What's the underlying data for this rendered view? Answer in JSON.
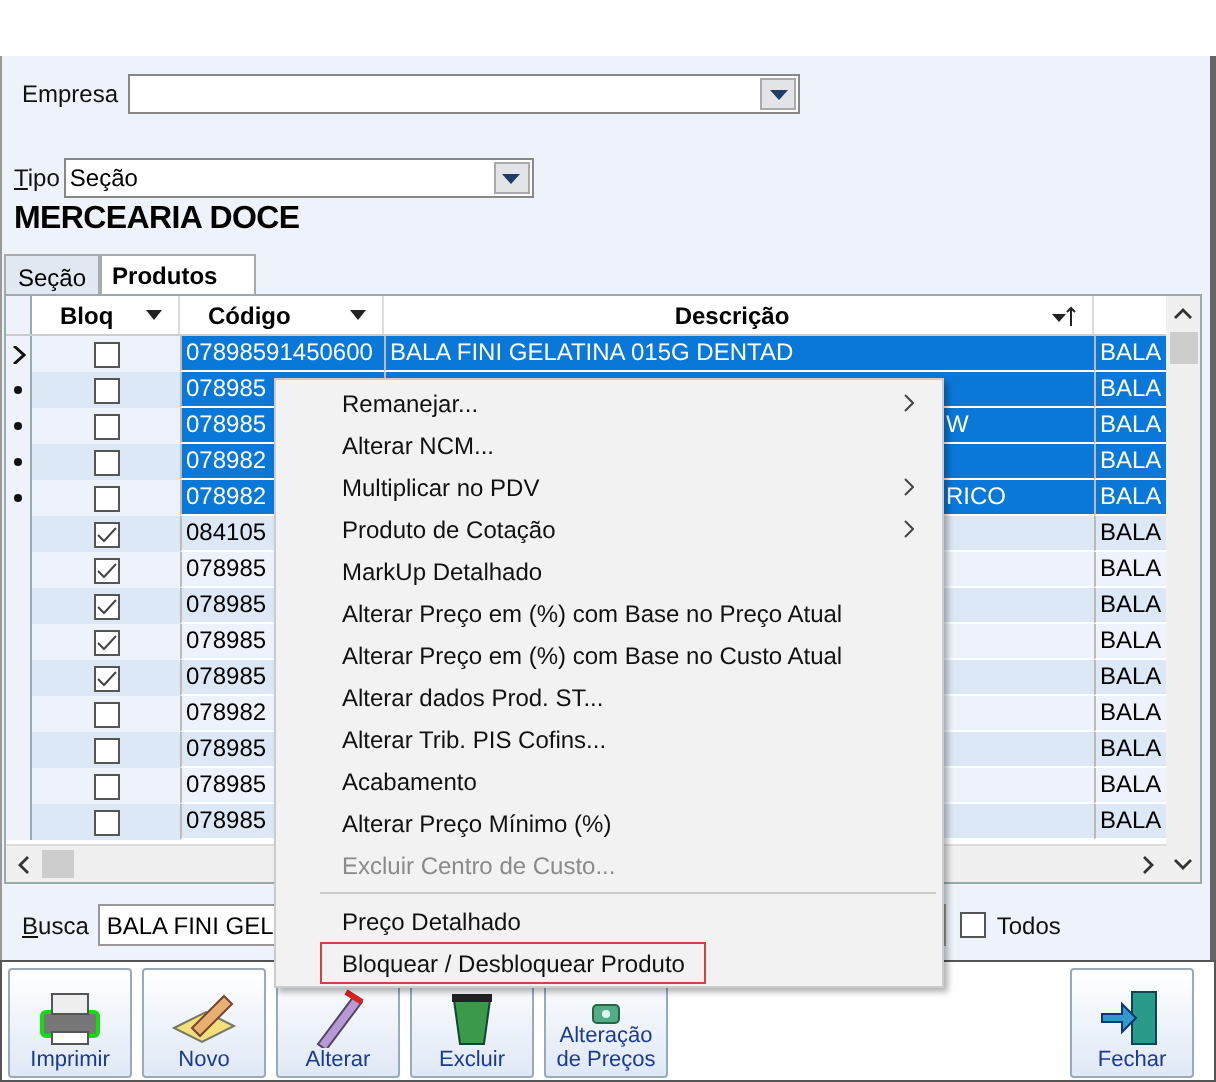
{
  "empresa": {
    "label": "Empresa"
  },
  "tipo": {
    "label": "Tipo",
    "value": "Seção"
  },
  "section_title": "MERCEARIA DOCE",
  "tabs": [
    {
      "label": "Seção",
      "selected": false
    },
    {
      "label": "Produtos",
      "selected": true
    }
  ],
  "table": {
    "columns": [
      "Bloq",
      "Código",
      "Descrição"
    ],
    "rows": [
      {
        "current": true,
        "selected": true,
        "checked": false,
        "code": "07898591450600",
        "description": "BALA FINI GELATINA 015G DENTAD",
        "column_4": "BALA"
      },
      {
        "current": false,
        "selected": true,
        "checked": false,
        "code": "078985",
        "description": "",
        "column_4": "BALA"
      },
      {
        "current": false,
        "selected": true,
        "checked": false,
        "code": "078985",
        "description": "W",
        "column_4": "BALA"
      },
      {
        "current": false,
        "selected": true,
        "checked": false,
        "code": "078982",
        "description": "",
        "column_4": "BALA"
      },
      {
        "current": false,
        "selected": true,
        "checked": false,
        "code": "078982",
        "description": "RICO",
        "column_4": "BALA"
      },
      {
        "current": false,
        "selected": false,
        "checked": true,
        "code": "084105",
        "description": "",
        "column_4": "BALA"
      },
      {
        "current": false,
        "selected": false,
        "checked": true,
        "code": "078985",
        "description": "",
        "column_4": "BALA"
      },
      {
        "current": false,
        "selected": false,
        "checked": true,
        "code": "078985",
        "description": "",
        "column_4": "BALA"
      },
      {
        "current": false,
        "selected": false,
        "checked": true,
        "code": "078985",
        "description": "",
        "column_4": "BALA"
      },
      {
        "current": false,
        "selected": false,
        "checked": true,
        "code": "078985",
        "description": "",
        "column_4": "BALA"
      },
      {
        "current": false,
        "selected": false,
        "checked": false,
        "code": "078982",
        "description": "",
        "column_4": "BALA"
      },
      {
        "current": false,
        "selected": false,
        "checked": false,
        "code": "078985",
        "description": "",
        "column_4": "BALA"
      },
      {
        "current": false,
        "selected": false,
        "checked": false,
        "code": "078985",
        "description": "",
        "column_4": "BALA"
      },
      {
        "current": false,
        "selected": false,
        "checked": false,
        "code": "078985",
        "description": "",
        "column_4": "BALA"
      }
    ]
  },
  "busca": {
    "label": "Busca",
    "value": "BALA FINI GEL"
  },
  "todos": {
    "label": "Todos",
    "checked": false
  },
  "toolbar": [
    {
      "kind": "print",
      "label": "Imprimir"
    },
    {
      "kind": "new",
      "label": "Novo"
    },
    {
      "kind": "edit",
      "label": "Alterar"
    },
    {
      "kind": "delete",
      "label": "Excluir"
    },
    {
      "kind": "prices",
      "label": "Alteração de Preços"
    },
    {
      "kind": "close",
      "label": "Fechar"
    }
  ],
  "context_menu": [
    {
      "kind": "item",
      "label": "Remanejar...",
      "submenu": true,
      "disabled": false,
      "selected": false
    },
    {
      "kind": "item",
      "label": "Alterar NCM...",
      "submenu": false,
      "disabled": false,
      "selected": false
    },
    {
      "kind": "item",
      "label": "Multiplicar no PDV",
      "submenu": true,
      "disabled": false,
      "selected": false
    },
    {
      "kind": "item",
      "label": "Produto de Cotação",
      "submenu": true,
      "disabled": false,
      "selected": false
    },
    {
      "kind": "item",
      "label": "MarkUp Detalhado",
      "submenu": false,
      "disabled": false,
      "selected": false
    },
    {
      "kind": "item",
      "label": "Alterar Preço em (%) com Base no Preço Atual",
      "submenu": false,
      "disabled": false,
      "selected": false
    },
    {
      "kind": "item",
      "label": "Alterar Preço em (%) com Base no Custo Atual",
      "submenu": false,
      "disabled": false,
      "selected": false
    },
    {
      "kind": "item",
      "label": "Alterar dados Prod. ST...",
      "submenu": false,
      "disabled": false,
      "selected": false
    },
    {
      "kind": "item",
      "label": "Alterar Trib. PIS Cofins...",
      "submenu": false,
      "disabled": false,
      "selected": false
    },
    {
      "kind": "item",
      "label": "Acabamento",
      "submenu": false,
      "disabled": false,
      "selected": false
    },
    {
      "kind": "item",
      "label": "Alterar Preço Mínimo (%)",
      "submenu": false,
      "disabled": false,
      "selected": false
    },
    {
      "kind": "item",
      "label": "Excluir Centro de Custo...",
      "submenu": false,
      "disabled": true,
      "selected": false
    },
    {
      "kind": "separator"
    },
    {
      "kind": "item",
      "label": "Preço Detalhado",
      "submenu": false,
      "disabled": false,
      "selected": false
    },
    {
      "kind": "item",
      "label": "Bloquear / Desbloquear Produto",
      "submenu": false,
      "disabled": false,
      "selected": true
    }
  ]
}
